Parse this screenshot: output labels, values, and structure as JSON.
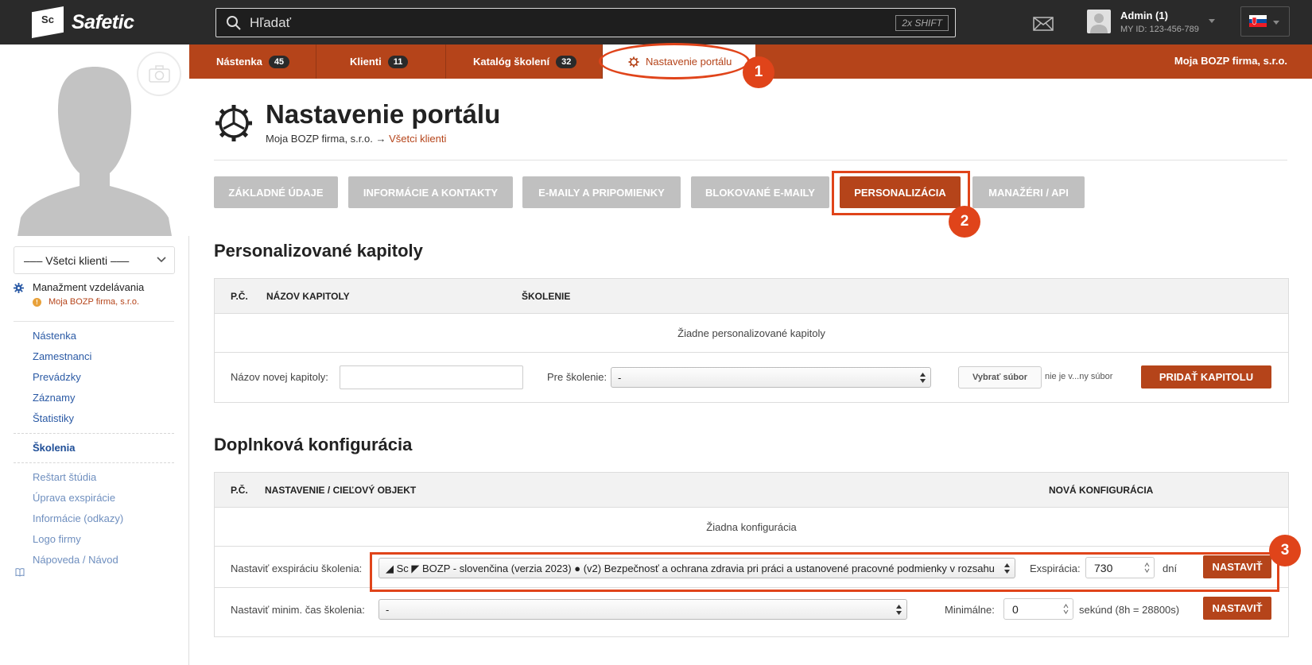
{
  "brand": {
    "logo_mark": "Sc",
    "logo_text": "Safetic"
  },
  "search": {
    "placeholder": "Hľadať",
    "shortcut": "2x SHIFT"
  },
  "user": {
    "name": "Admin (1)",
    "id": "MY ID: 123-456-789"
  },
  "sidebar": {
    "client_select": "––– Všetci klienti –––",
    "mgmt_title": "Manažment vzdelávania",
    "mgmt_sub": "Moja BOZP firma, s.r.o.",
    "mgmt_warn": "!",
    "links": [
      "Nástenka",
      "Zamestnanci",
      "Prevádzky",
      "Záznamy",
      "Štatistiky"
    ],
    "active_link": "Školenia",
    "sublinks": [
      "Reštart štúdia",
      "Úprava exspirácie",
      "Informácie (odkazy)",
      "Logo firmy"
    ],
    "help_link": "Nápoveda / Návod"
  },
  "nav": {
    "tabs": [
      {
        "label": "Nástenka",
        "count": "45"
      },
      {
        "label": "Klienti",
        "count": "11"
      },
      {
        "label": "Katalóg školení",
        "count": "32"
      }
    ],
    "active_tab": "Nastavenie portálu",
    "firm": "Moja BOZP firma, s.r.o."
  },
  "annotations": [
    "1",
    "2",
    "3"
  ],
  "page": {
    "title": "Nastavenie portálu",
    "crumb_root": "Moja BOZP firma, s.r.o.",
    "crumb_arrow": "→",
    "crumb_link": "Všetci klienti"
  },
  "subtabs": [
    "ZÁKLADNÉ ÚDAJE",
    "INFORMÁCIE A KONTAKTY",
    "E-MAILY A PRIPOMIENKY",
    "BLOKOVANÉ E-MAILY",
    "PERSONALIZÁCIA",
    "MANAŽÉRI / API"
  ],
  "chapters": {
    "title": "Personalizované kapitoly",
    "headers": [
      "P.Č.",
      "NÁZOV KAPITOLY",
      "ŠKOLENIE"
    ],
    "empty": "Žiadne personalizované kapitoly",
    "new_label": "Názov novej kapitoly:",
    "new_value": "",
    "for_label": "Pre školenie:",
    "for_value": "-",
    "file_button": "Vybrať súbor",
    "file_text": "nie je v...ny súbor",
    "add_button": "PRIDAŤ KAPITOLU"
  },
  "config": {
    "title": "Doplnková konfigurácia",
    "headers": [
      "P.Č.",
      "NASTAVENIE / CIEĽOVÝ OBJEKT",
      "NOVÁ KONFIGURÁCIA"
    ],
    "empty": "Žiadna konfigurácia",
    "exp_label": "Nastaviť exspiráciu školenia:",
    "exp_select": "◢ Sc ◤   BOZP - slovenčina (verzia 2023)   ●   (v2) Bezpečnosť a ochrana zdravia pri práci a ustanovené pracovné podmienky v rozsahu",
    "exp_field_label": "Exspirácia:",
    "exp_value": "730",
    "exp_unit": "dní",
    "exp_button": "NASTAVIŤ",
    "min_label": "Nastaviť minim. čas školenia:",
    "min_select": "-",
    "min_field_label": "Minimálne:",
    "min_value": "0",
    "min_unit": "sekúnd (8h = 28800s)",
    "min_button": "NASTAVIŤ"
  },
  "colors": {
    "accent": "#b5441a",
    "annotation": "#e0441a",
    "topbar": "#2a2a2a"
  }
}
